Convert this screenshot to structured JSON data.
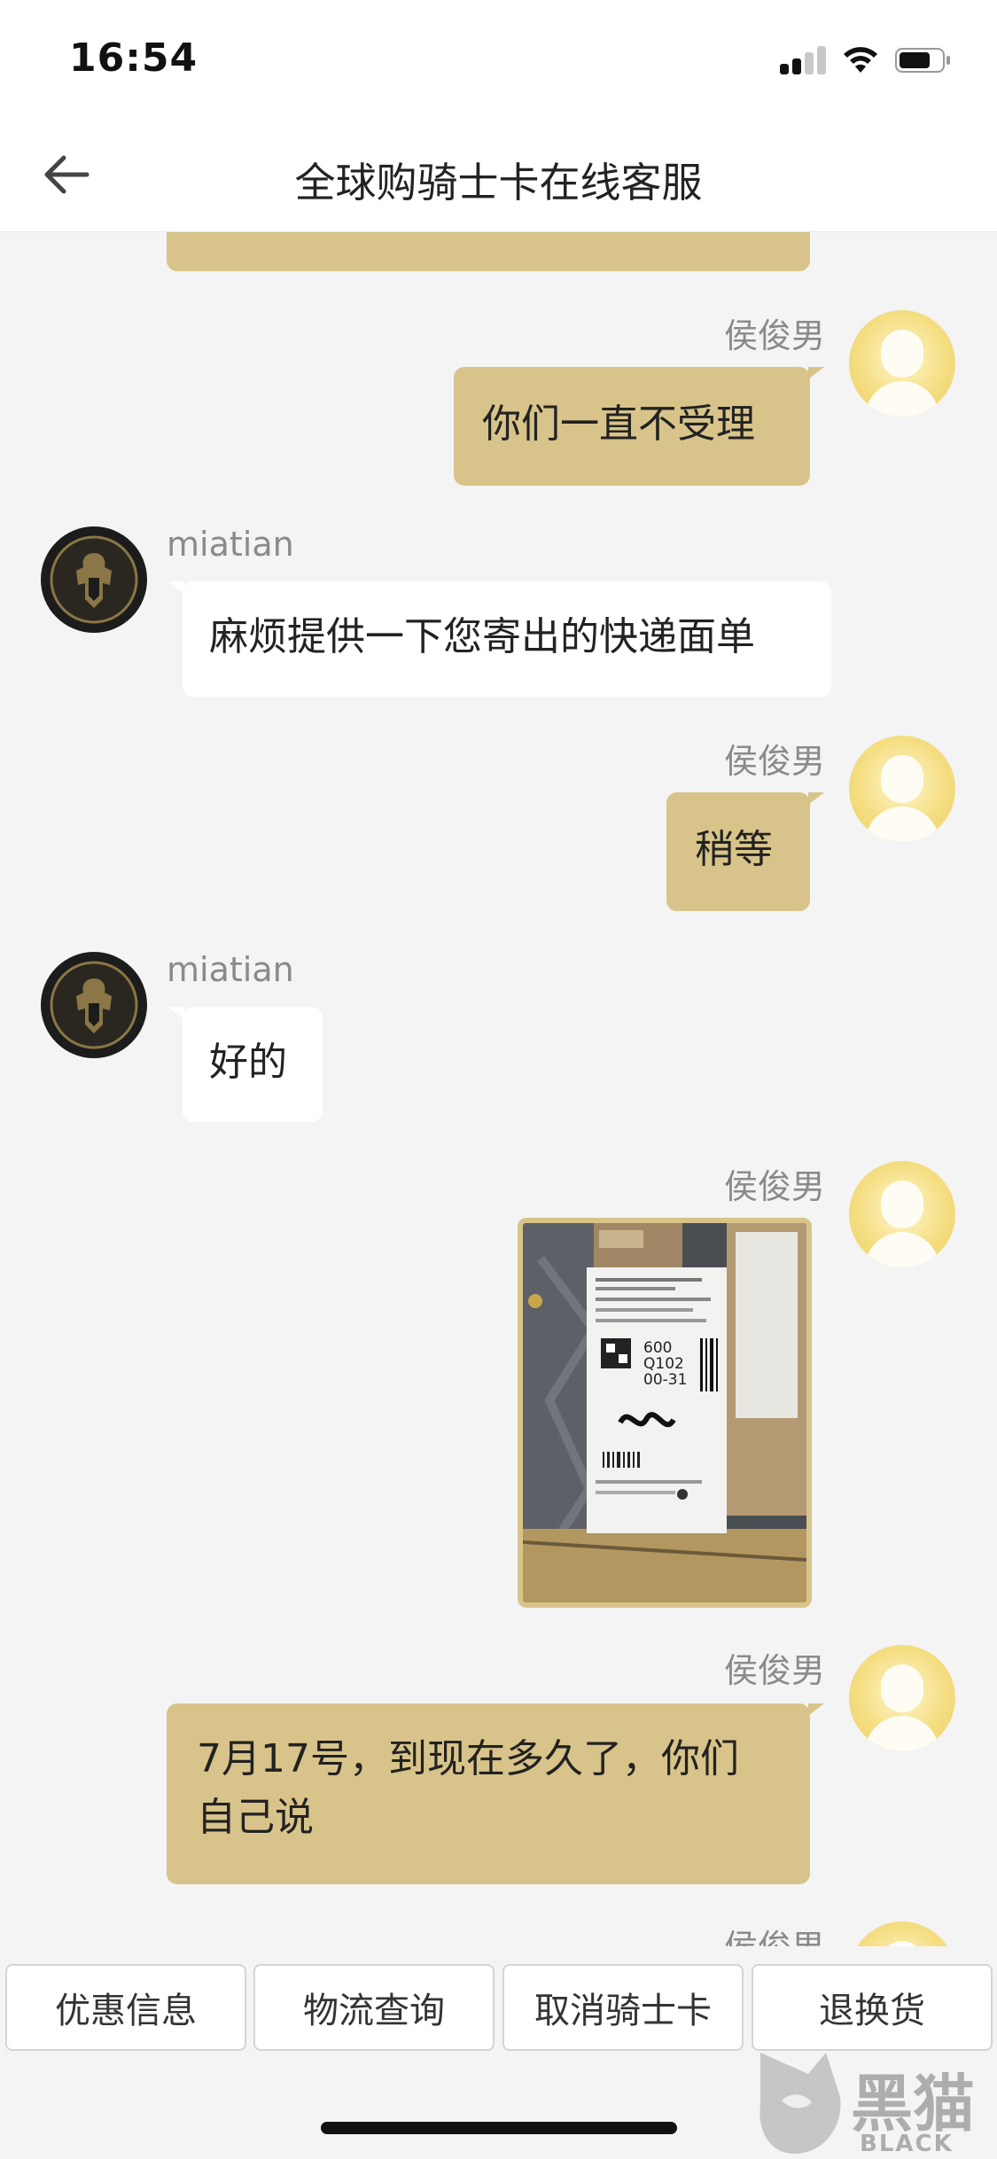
{
  "status_bar": {
    "time": "16:54"
  },
  "nav": {
    "title": "全球购骑士卡在线客服"
  },
  "messages": [
    {
      "sender": "侯俊男",
      "text": "你们一直不受理"
    },
    {
      "sender": "miatian",
      "text": "麻烦提供一下您寄出的快递面单"
    },
    {
      "sender": "侯俊男",
      "text": "稍等"
    },
    {
      "sender": "miatian",
      "text": "好的"
    },
    {
      "sender": "侯俊男",
      "image_text": [
        "600",
        "Q102",
        "00-31"
      ]
    },
    {
      "sender": "侯俊男",
      "lines": [
        "7月17号，到现在多久了，你们",
        "自己说"
      ]
    },
    {
      "sender": "侯俊男"
    }
  ],
  "quick_replies": [
    "优惠信息",
    "物流查询",
    "取消骑士卡",
    "退换货"
  ],
  "watermark": {
    "title": "黑猫",
    "subtitle": "BLACK CAT"
  },
  "colors": {
    "outgoing_bubble": "#d8c48a",
    "incoming_bubble": "#ffffff",
    "background": "#f4f4f4"
  }
}
